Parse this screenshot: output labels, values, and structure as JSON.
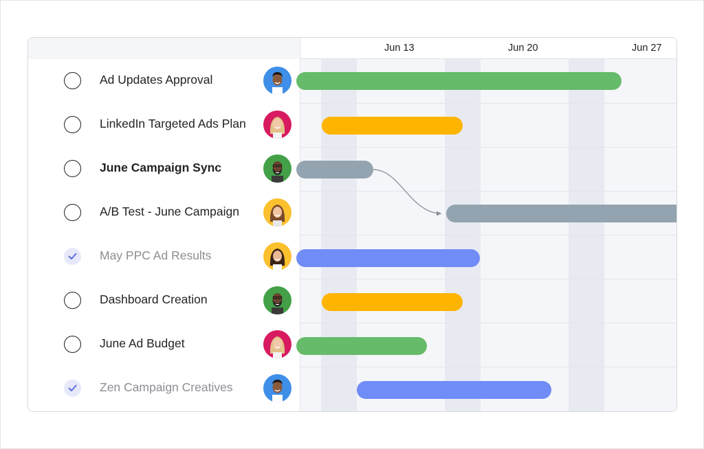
{
  "timeline": {
    "dates": [
      "Jun 13",
      "Jun 20",
      "Jun 27"
    ]
  },
  "tasks": [
    {
      "name": "Ad Updates Approval",
      "completed": false,
      "avatar": "avatar-man-dark-hair",
      "bar_color": "#66bb6a"
    },
    {
      "name": "LinkedIn Targeted Ads Plan",
      "completed": false,
      "avatar": "avatar-woman-blonde",
      "bar_color": "#ffb400"
    },
    {
      "name": "June Campaign Sync",
      "completed": false,
      "avatar": "avatar-man-bearded",
      "bar_color": "#93a4b0"
    },
    {
      "name": "A/B Test - June Campaign",
      "completed": false,
      "avatar": "avatar-woman-brown-hair",
      "bar_color": "#93a4b0"
    },
    {
      "name": "May PPC Ad Results",
      "completed": true,
      "avatar": "avatar-woman-dark-hair",
      "bar_color": "#6f8cf7"
    },
    {
      "name": "Dashboard Creation",
      "completed": false,
      "avatar": "avatar-man-bearded",
      "bar_color": "#ffb400"
    },
    {
      "name": "June Ad Budget",
      "completed": false,
      "avatar": "avatar-woman-blonde",
      "bar_color": "#66bb6a"
    },
    {
      "name": "Zen Campaign Creatives",
      "completed": true,
      "avatar": "avatar-man-dark-hair",
      "bar_color": "#6f8cf7"
    }
  ],
  "dependency": {
    "from": "June Campaign Sync",
    "to": "A/B Test - June Campaign"
  },
  "colors": {
    "green": "#66bb6a",
    "yellow": "#ffb400",
    "gray": "#93a4b0",
    "blue": "#6f8cf7",
    "check_done_bg": "#e7e9fb",
    "check_done_mark": "#5b6ee0"
  }
}
